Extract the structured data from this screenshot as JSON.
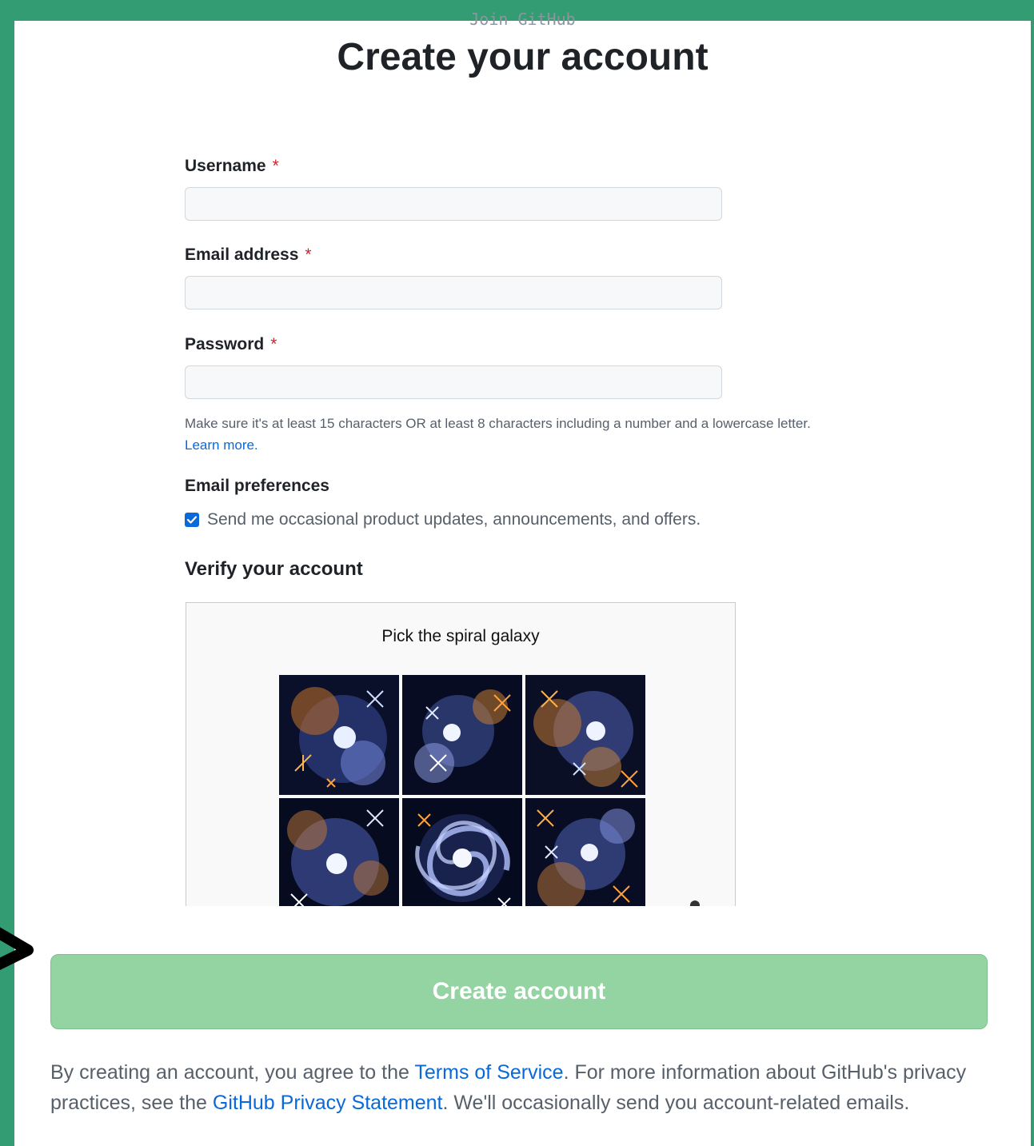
{
  "header": {
    "eyebrow": "Join GitHub",
    "title": "Create your account"
  },
  "form": {
    "username_label": "Username",
    "email_label": "Email address",
    "password_label": "Password",
    "required_mark": "*",
    "password_hint": "Make sure it's at least 15 characters OR at least 8 characters including a number and a lowercase letter.",
    "learn_more": "Learn more.",
    "email_pref_heading": "Email preferences",
    "email_pref_checkbox_label": "Send me occasional product updates, announcements, and offers.",
    "email_pref_checked": true,
    "verify_heading": "Verify your account"
  },
  "captcha": {
    "prompt": "Pick the spiral galaxy",
    "tiles": [
      {
        "label": "galaxy-image-1"
      },
      {
        "label": "galaxy-image-2"
      },
      {
        "label": "galaxy-image-3"
      },
      {
        "label": "galaxy-image-4"
      },
      {
        "label": "galaxy-image-5-spiral"
      },
      {
        "label": "galaxy-image-6"
      }
    ]
  },
  "submit": {
    "label": "Create account"
  },
  "legal": {
    "part1": "By creating an account, you agree to the ",
    "terms_link": "Terms of Service",
    "part2": ". For more information about GitHub's privacy practices, see the ",
    "privacy_link": "GitHub Privacy Statement",
    "part3": ". We'll occasionally send you account-related emails."
  },
  "colors": {
    "background": "#339c73",
    "link": "#0969da",
    "required": "#cf222e",
    "button": "#94d3a2"
  }
}
